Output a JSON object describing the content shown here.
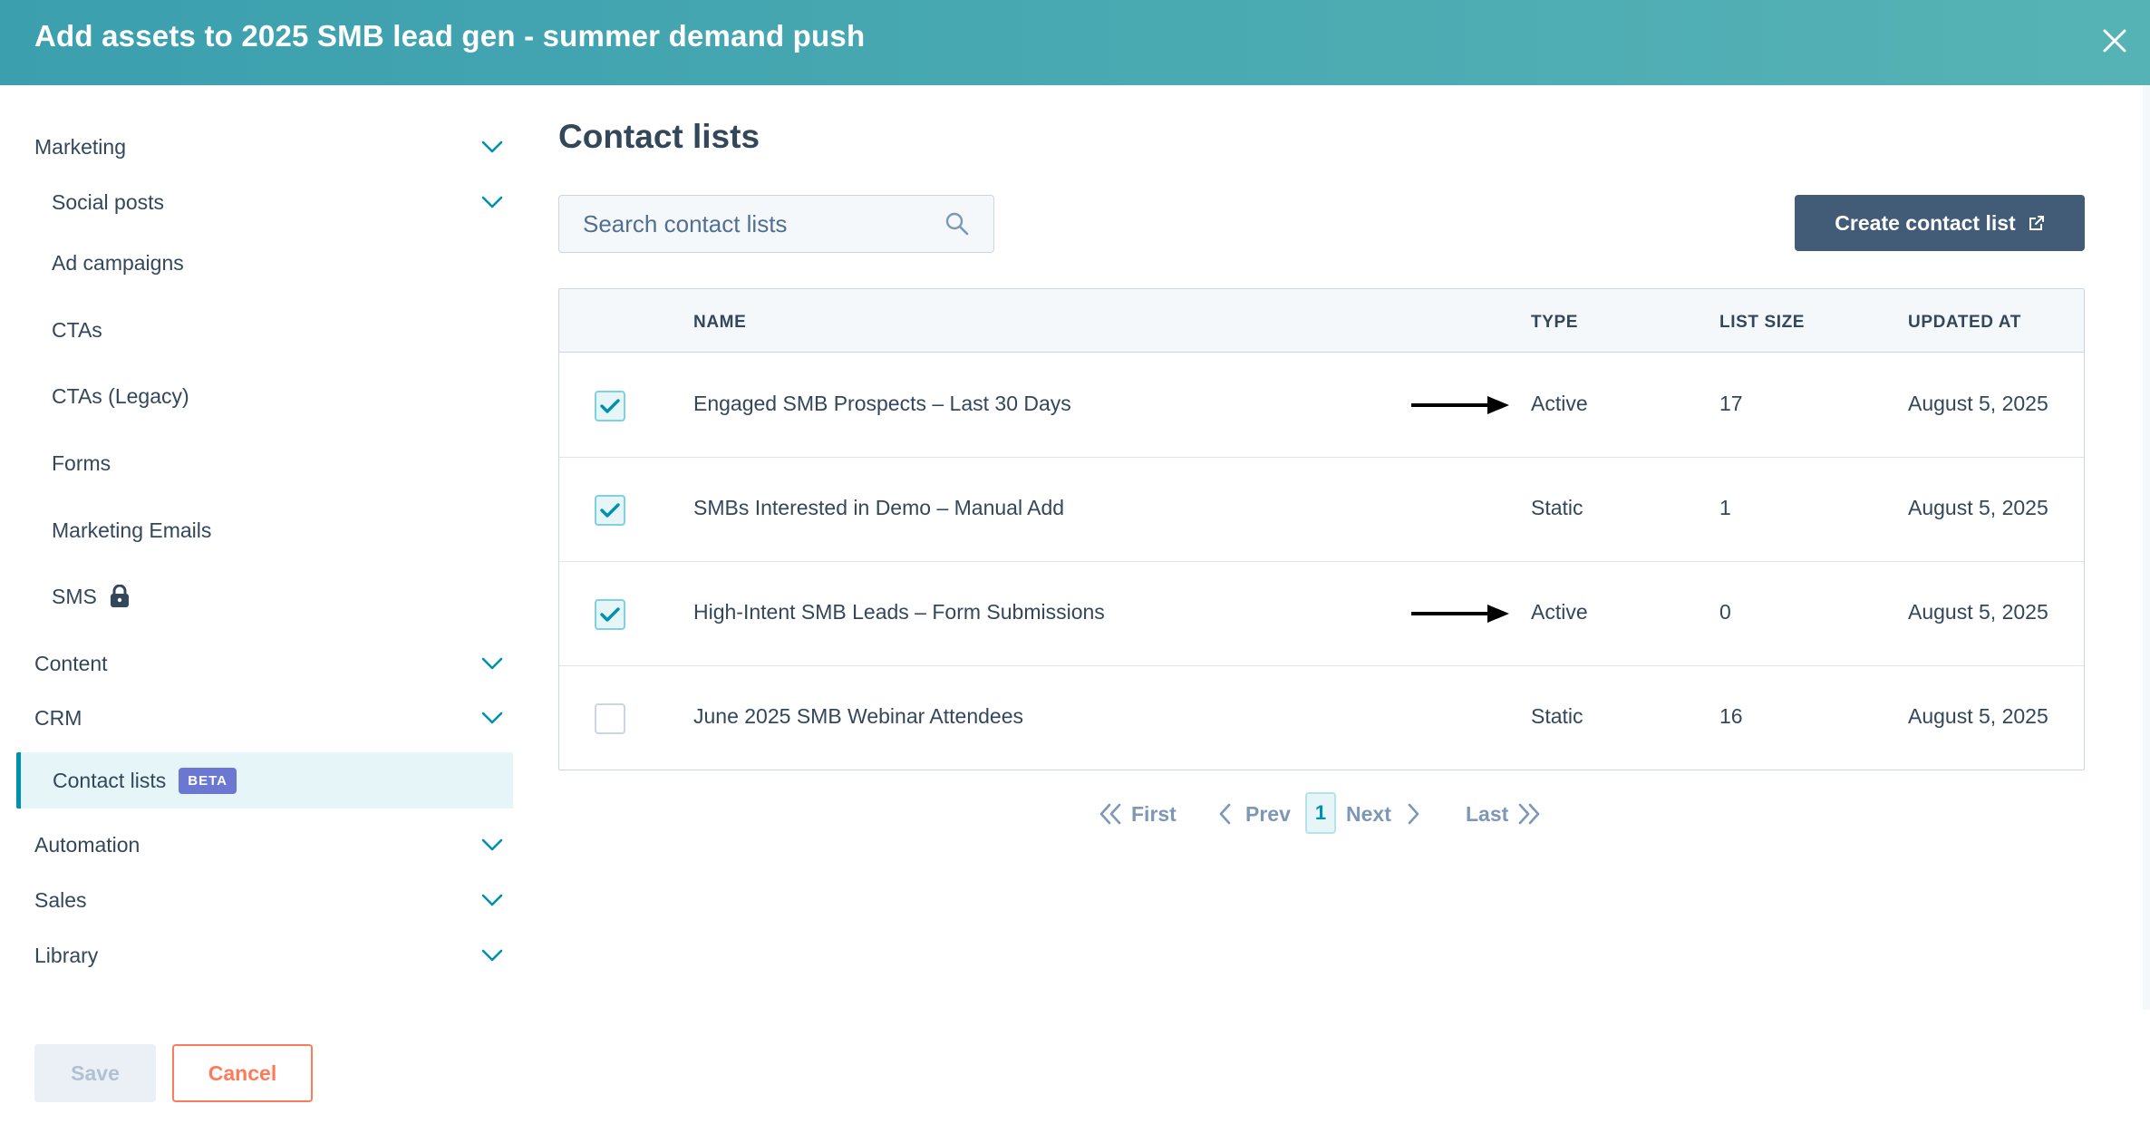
{
  "header": {
    "title": "Add assets to 2025 SMB lead gen - summer demand push"
  },
  "sidebar": {
    "marketing": "Marketing",
    "marketing_items": [
      "Social posts",
      "Ad campaigns",
      "CTAs",
      "CTAs (Legacy)",
      "Forms",
      "Marketing Emails",
      "SMS"
    ],
    "content": "Content",
    "crm": "CRM",
    "active_item": {
      "label": "Contact lists",
      "badge": "BETA"
    },
    "automation": "Automation",
    "sales": "Sales",
    "library": "Library"
  },
  "footer": {
    "save_label": "Save",
    "cancel_label": "Cancel"
  },
  "main": {
    "title": "Contact lists",
    "search_placeholder": "Search contact lists",
    "create_label": "Create contact list"
  },
  "table": {
    "columns": [
      "NAME",
      "TYPE",
      "LIST SIZE",
      "UPDATED AT"
    ],
    "rows": [
      {
        "checked": true,
        "name": "Engaged SMB Prospects – Last 30 Days",
        "type": "Active",
        "size": "17",
        "updated": "August 5, 2025",
        "arrow": true
      },
      {
        "checked": true,
        "name": "SMBs Interested in Demo – Manual Add",
        "type": "Static",
        "size": "1",
        "updated": "August 5, 2025",
        "arrow": false
      },
      {
        "checked": true,
        "name": "High-Intent SMB Leads – Form Submissions",
        "type": "Active",
        "size": "0",
        "updated": "August 5, 2025",
        "arrow": true
      },
      {
        "checked": false,
        "name": "June 2025 SMB Webinar Attendees",
        "type": "Static",
        "size": "16",
        "updated": "August 5, 2025",
        "arrow": false
      }
    ]
  },
  "pagination": {
    "first": "First",
    "prev": "Prev",
    "page": "1",
    "next": "Next",
    "last": "Last"
  },
  "colors": {
    "accent": "#0091ae",
    "header_start": "#3b9fae",
    "header_end": "#56b3b5",
    "primary_button": "#425b76",
    "cancel": "#ff7a59",
    "beta": "#6a78d1"
  }
}
